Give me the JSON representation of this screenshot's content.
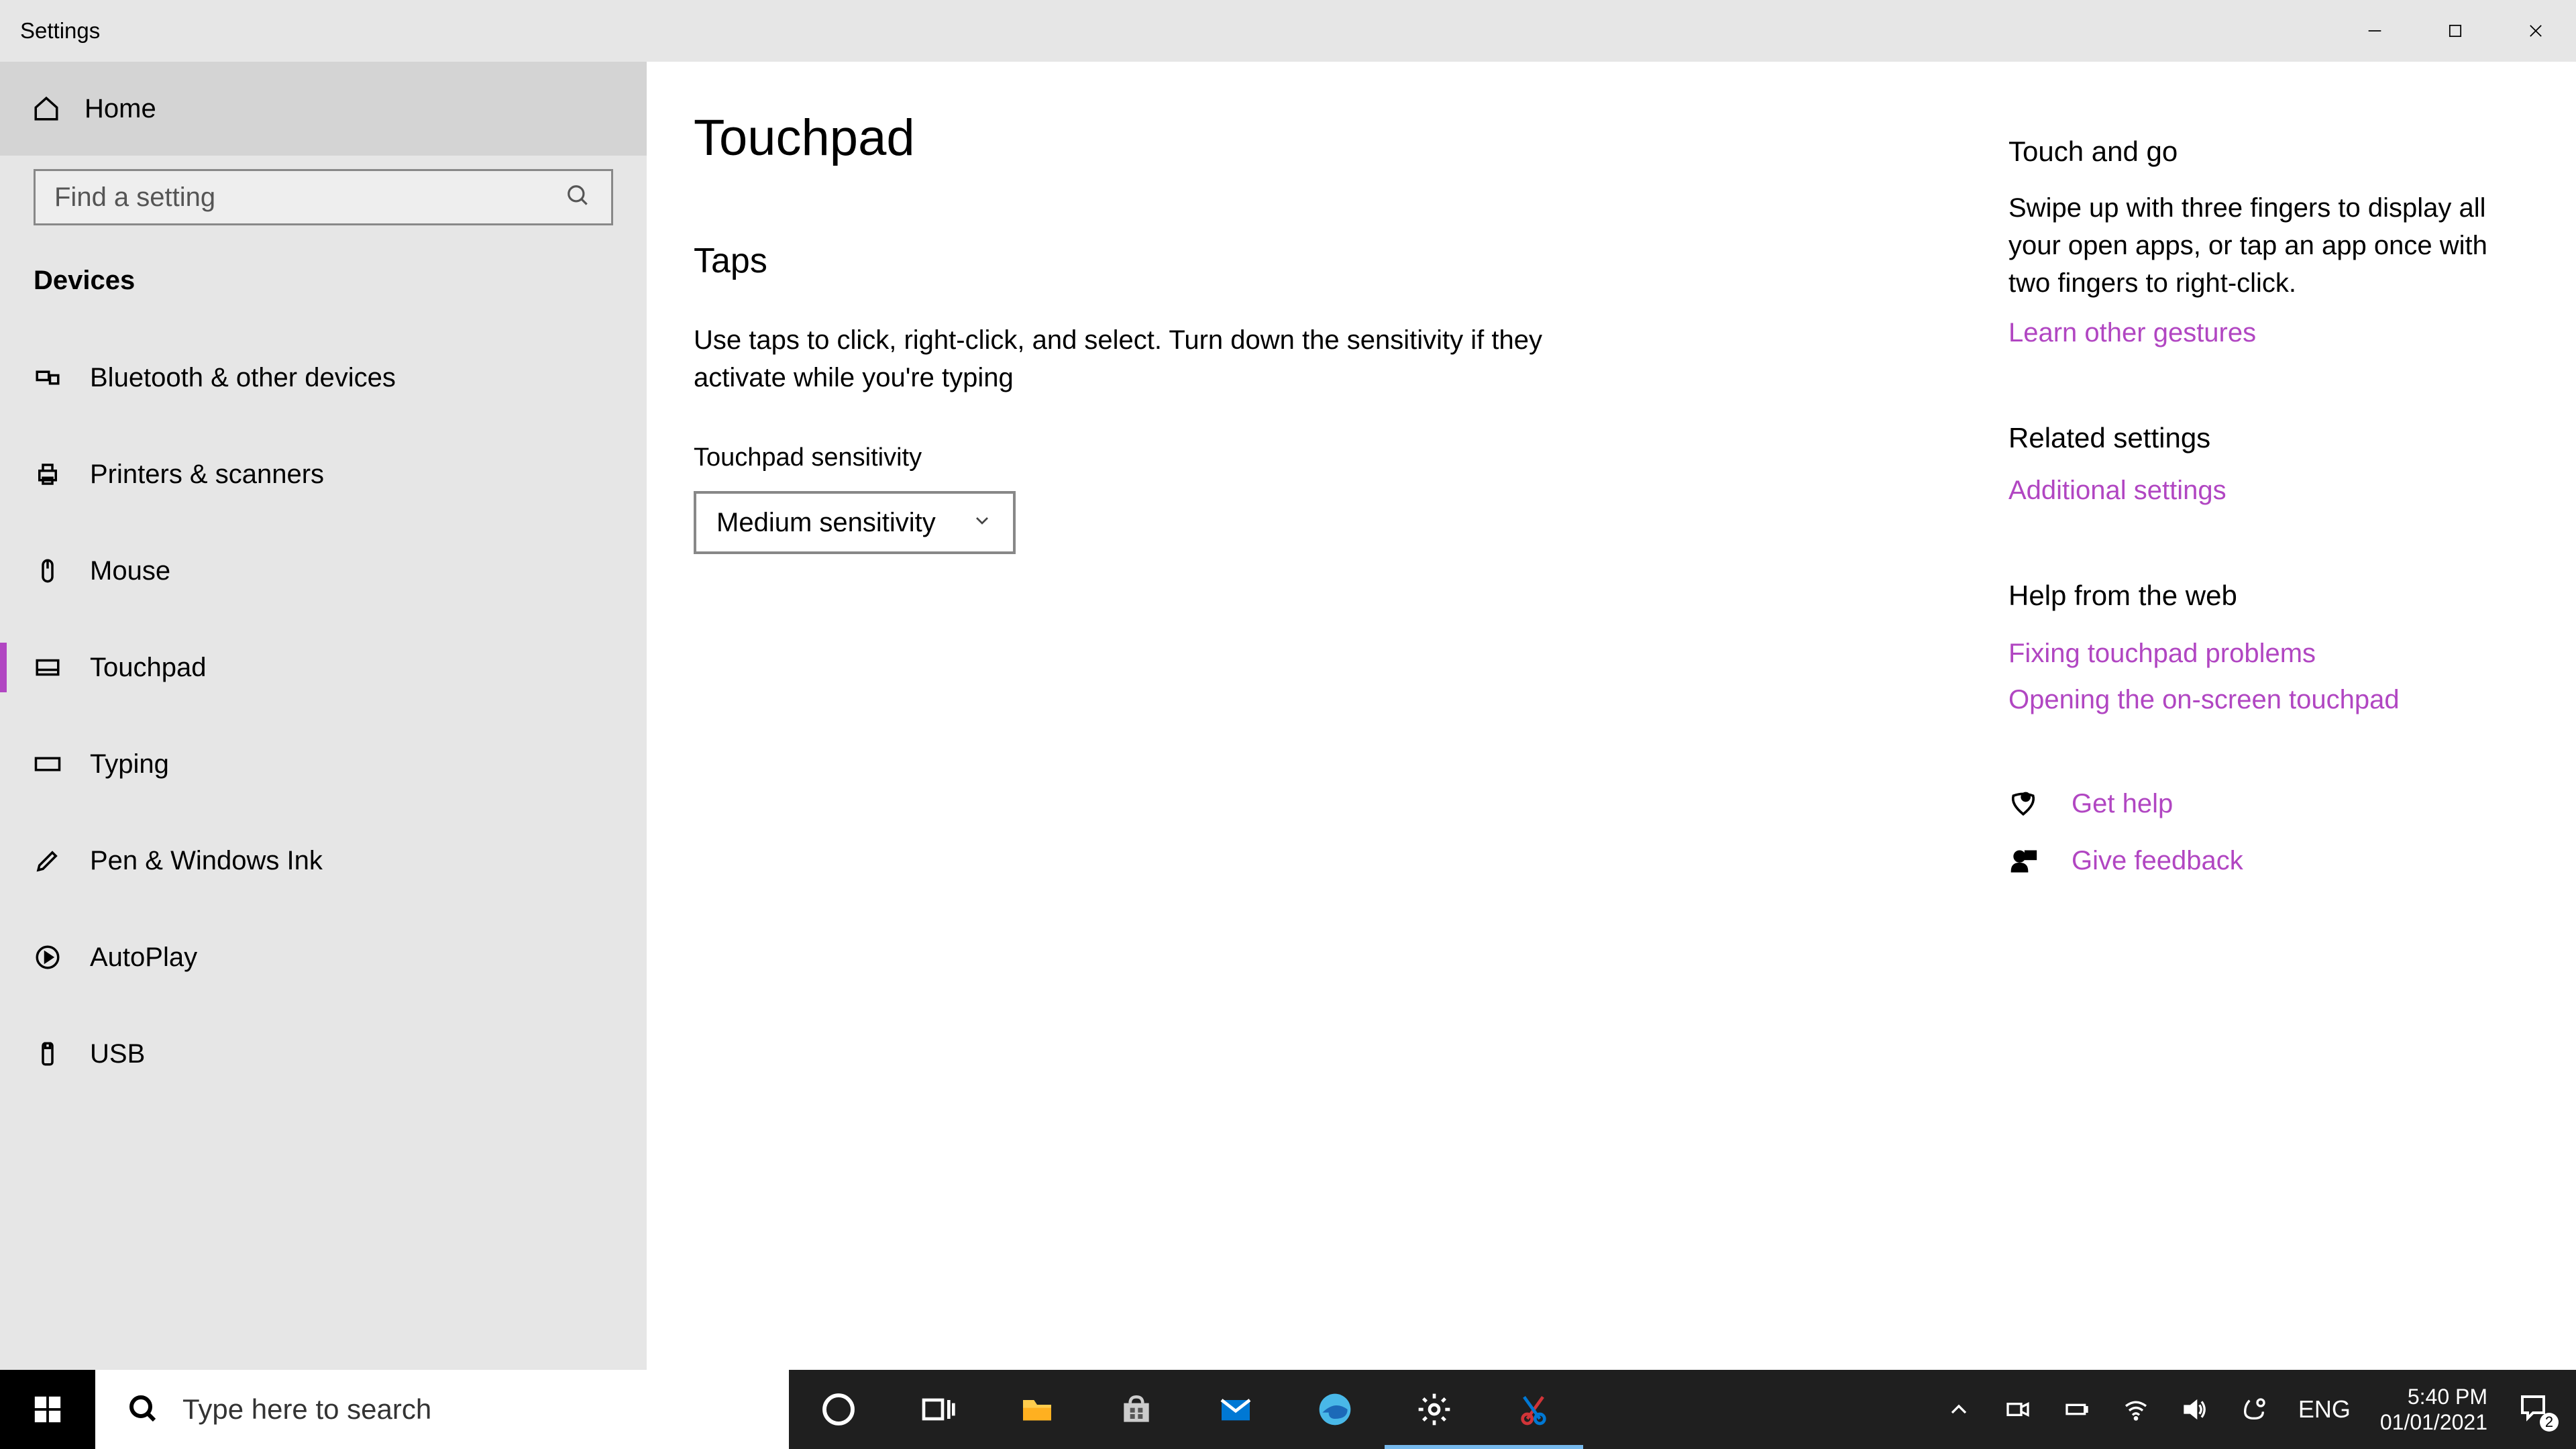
{
  "window": {
    "title": "Settings"
  },
  "sidebar": {
    "home_label": "Home",
    "search_placeholder": "Find a setting",
    "category_label": "Devices",
    "items": [
      {
        "label": "Bluetooth & other devices"
      },
      {
        "label": "Printers & scanners"
      },
      {
        "label": "Mouse"
      },
      {
        "label": "Touchpad"
      },
      {
        "label": "Typing"
      },
      {
        "label": "Pen & Windows Ink"
      },
      {
        "label": "AutoPlay"
      },
      {
        "label": "USB"
      }
    ]
  },
  "main": {
    "page_title": "Touchpad",
    "section_title": "Taps",
    "section_desc": "Use taps to click, right-click, and select. Turn down the sensitivity if they activate while you're typing",
    "field_label": "Touchpad sensitivity",
    "dropdown_value": "Medium sensitivity"
  },
  "aside": {
    "sec1_title": "Touch and go",
    "sec1_desc": "Swipe up with three fingers to display all your open apps, or tap an app once with two fingers to right-click.",
    "sec1_link": "Learn other gestures",
    "sec2_title": "Related settings",
    "sec2_link": "Additional settings",
    "sec3_title": "Help from the web",
    "sec3_link1": "Fixing touchpad problems",
    "sec3_link2": "Opening the on-screen touchpad",
    "help_label": "Get help",
    "feedback_label": "Give feedback"
  },
  "taskbar": {
    "search_placeholder": "Type here to search",
    "lang": "ENG",
    "time": "5:40 PM",
    "date": "01/01/2021",
    "notif_count": "2"
  }
}
